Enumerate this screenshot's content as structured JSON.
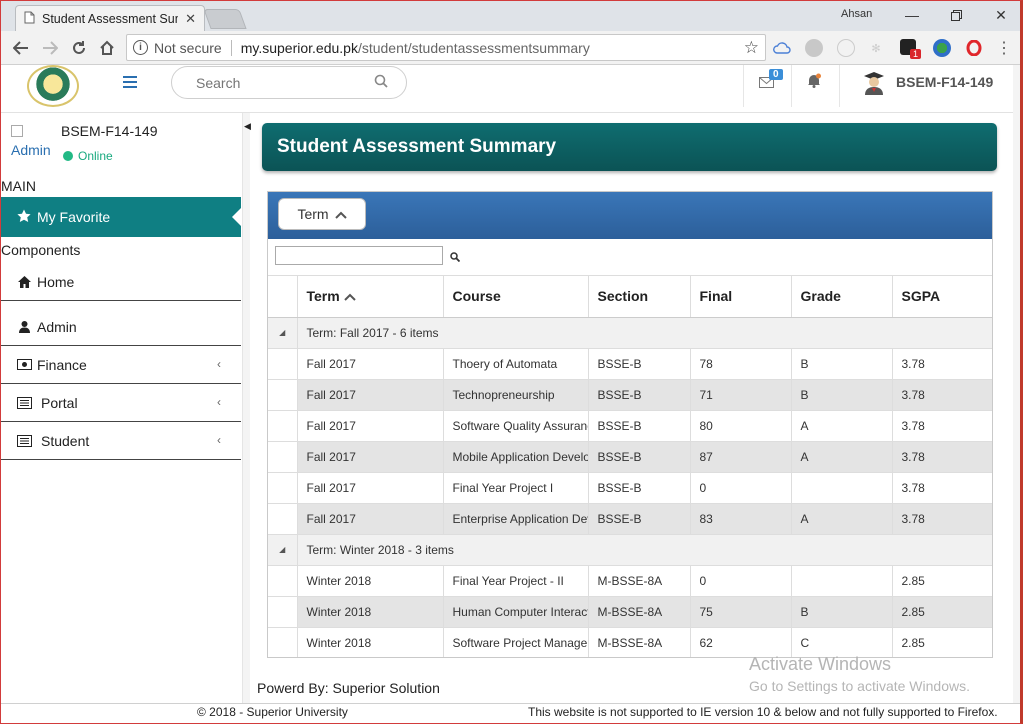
{
  "browser": {
    "tab_title": "Student Assessment Sum",
    "profile_name": "Ahsan",
    "security_label": "Not secure",
    "url_host": "my.superior.edu.pk",
    "url_path": "/student/studentassessmentsummary",
    "extension_badge": "1"
  },
  "header": {
    "search_placeholder": "Search",
    "mail_count": "0",
    "username": "BSEM-F14-149"
  },
  "sidebar": {
    "profile_alt": "Admin",
    "profile_name": "BSEM-F14-149",
    "status": "Online",
    "main_label": "MAIN",
    "favorite_label": "My Favorite",
    "components_label": "Components",
    "items": [
      {
        "label": "Home",
        "icon": "home-icon"
      },
      {
        "label": "Admin",
        "icon": "user-icon"
      },
      {
        "label": "Finance",
        "icon": "money-icon"
      },
      {
        "label": "Portal",
        "icon": "list-icon"
      },
      {
        "label": "Student",
        "icon": "list-icon"
      }
    ]
  },
  "page": {
    "title": "Student Assessment Summary",
    "group_chip": "Term",
    "columns": [
      "Term",
      "Course",
      "Section",
      "Final",
      "Grade",
      "SGPA"
    ],
    "groups": [
      {
        "label": "Term: Fall 2017 - 6 items",
        "rows": [
          [
            "Fall 2017",
            "Thoery of Automata",
            "BSSE-B",
            "78",
            "B",
            "3.78"
          ],
          [
            "Fall 2017",
            "Technopreneurship",
            "BSSE-B",
            "71",
            "B",
            "3.78"
          ],
          [
            "Fall 2017",
            "Software Quality Assurance",
            "BSSE-B",
            "80",
            "A",
            "3.78"
          ],
          [
            "Fall 2017",
            "Mobile Application Development",
            "BSSE-B",
            "87",
            "A",
            "3.78"
          ],
          [
            "Fall 2017",
            "Final Year Project I",
            "BSSE-B",
            "0",
            "",
            "3.78"
          ],
          [
            "Fall 2017",
            "Enterprise Application Development",
            "BSSE-B",
            "83",
            "A",
            "3.78"
          ]
        ]
      },
      {
        "label": "Term: Winter 2018 - 3 items",
        "rows": [
          [
            "Winter 2018",
            "Final Year Project - II",
            "M-BSSE-8A",
            "0",
            "",
            "2.85"
          ],
          [
            "Winter 2018",
            "Human Computer Interaction",
            "M-BSSE-8A",
            "75",
            "B",
            "2.85"
          ],
          [
            "Winter 2018",
            "Software Project Management",
            "M-BSSE-8A",
            "62",
            "C",
            "2.85"
          ]
        ]
      }
    ],
    "powered_by": "Powerd By: Superior Solution"
  },
  "watermark": {
    "line1": "Activate Windows",
    "line2": "Go to Settings to activate Windows."
  },
  "footer": {
    "copyright": "© 2018 - Superior University",
    "ie_notice": "This website is not supported to IE version 10 & below and not fully supported to Firefox."
  },
  "colors": {
    "accent_teal": "#0f7f83",
    "header_blue": "#3a76b8",
    "online_green": "#22b985"
  }
}
